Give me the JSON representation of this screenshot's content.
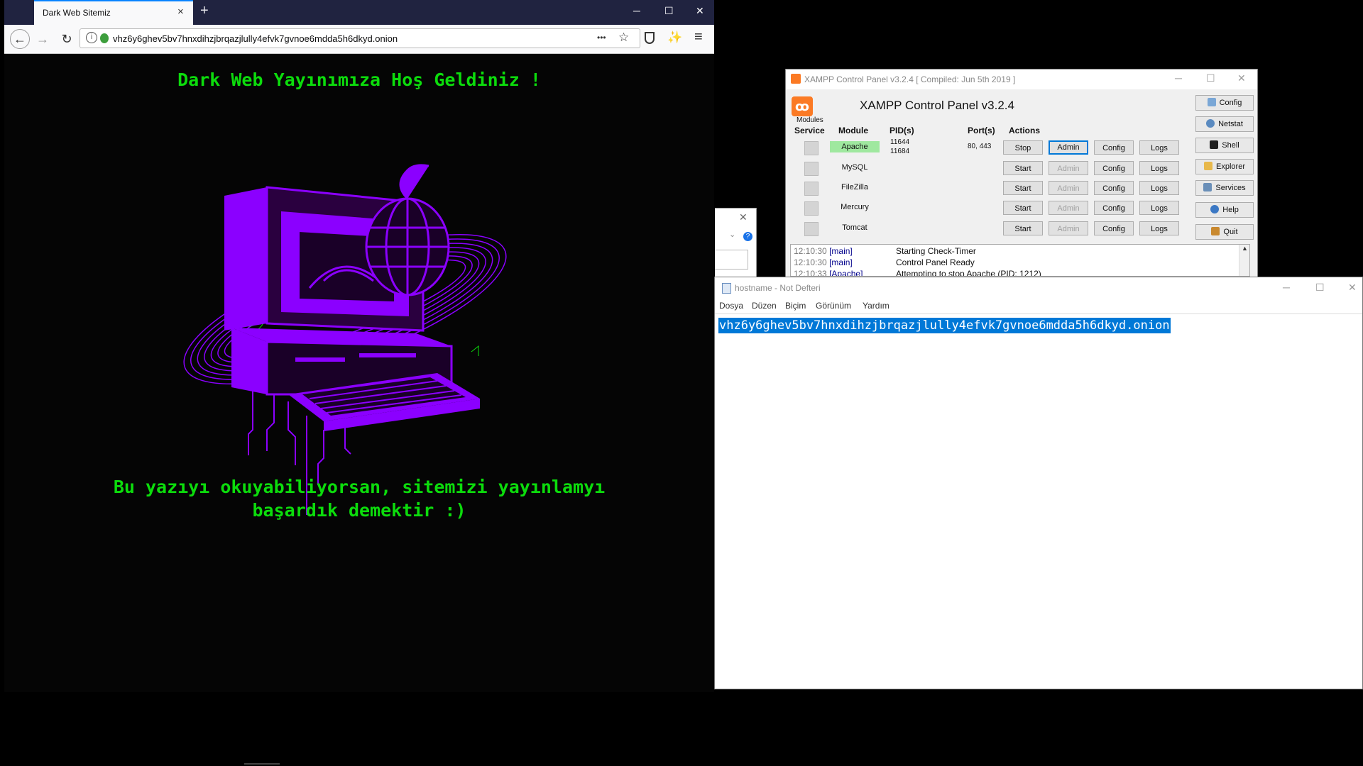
{
  "browser": {
    "tab_title": "Dark Web Sitemiz",
    "tab_close": "×",
    "new_tab": "+",
    "minimize": "─",
    "maximize": "☐",
    "close": "✕",
    "url": "vhz6y6ghev5bv7hnxdihzjbrqazjlully4efvk7gvnoe6mdda5h6dkyd.onion",
    "more": "•••",
    "menu": "≡",
    "page": {
      "heading": "Dark Web Yayınımıza Hoş Geldiniz !",
      "body": "Bu yazıyı okuyabiliyorsan, sitemizi yayınlamyı başardık demektir :)"
    }
  },
  "colors": {
    "accent_green": "#0cdc0c",
    "art_purple": "#8b00ff",
    "xampp_orange": "#fb7a24",
    "selection_blue": "#0078d7"
  },
  "xampp": {
    "window_title": "XAMPP Control Panel v3.2.4   [ Compiled: Jun 5th 2019 ]",
    "app_title": "XAMPP Control Panel v3.2.4",
    "modules_label": "Modules",
    "headers": {
      "service": "Service",
      "module": "Module",
      "pids": "PID(s)",
      "ports": "Port(s)",
      "actions": "Actions"
    },
    "rows": [
      {
        "module": "Apache",
        "pids": [
          "11644",
          "11684"
        ],
        "ports": "80, 443",
        "action": "Stop",
        "admin": "Admin",
        "config": "Config",
        "logs": "Logs"
      },
      {
        "module": "MySQL",
        "pids": [],
        "ports": "",
        "action": "Start",
        "admin": "Admin",
        "config": "Config",
        "logs": "Logs"
      },
      {
        "module": "FileZilla",
        "pids": [],
        "ports": "",
        "action": "Start",
        "admin": "Admin",
        "config": "Config",
        "logs": "Logs"
      },
      {
        "module": "Mercury",
        "pids": [],
        "ports": "",
        "action": "Start",
        "admin": "Admin",
        "config": "Config",
        "logs": "Logs"
      },
      {
        "module": "Tomcat",
        "pids": [],
        "ports": "",
        "action": "Start",
        "admin": "Admin",
        "config": "Config",
        "logs": "Logs"
      }
    ],
    "side_buttons": [
      "Config",
      "Netstat",
      "Shell",
      "Explorer",
      "Services",
      "Help",
      "Quit"
    ],
    "log": [
      {
        "time": "12:10:30",
        "source": "[main]",
        "message": "Starting Check-Timer"
      },
      {
        "time": "12:10:30",
        "source": "[main]",
        "message": "Control Panel Ready"
      },
      {
        "time": "12:10:33",
        "source": "[Apache]",
        "message": "Attempting to stop Apache (PID: 1212)"
      }
    ]
  },
  "notepad": {
    "title": "hostname - Not Defteri",
    "menu": [
      "Dosya",
      "Düzen",
      "Biçim",
      "Görünüm",
      "Yardım"
    ],
    "content": "vhz6y6ghev5bv7hnxdihzjbrqazjlully4efvk7gvnoe6mdda5h6dkyd.onion"
  }
}
